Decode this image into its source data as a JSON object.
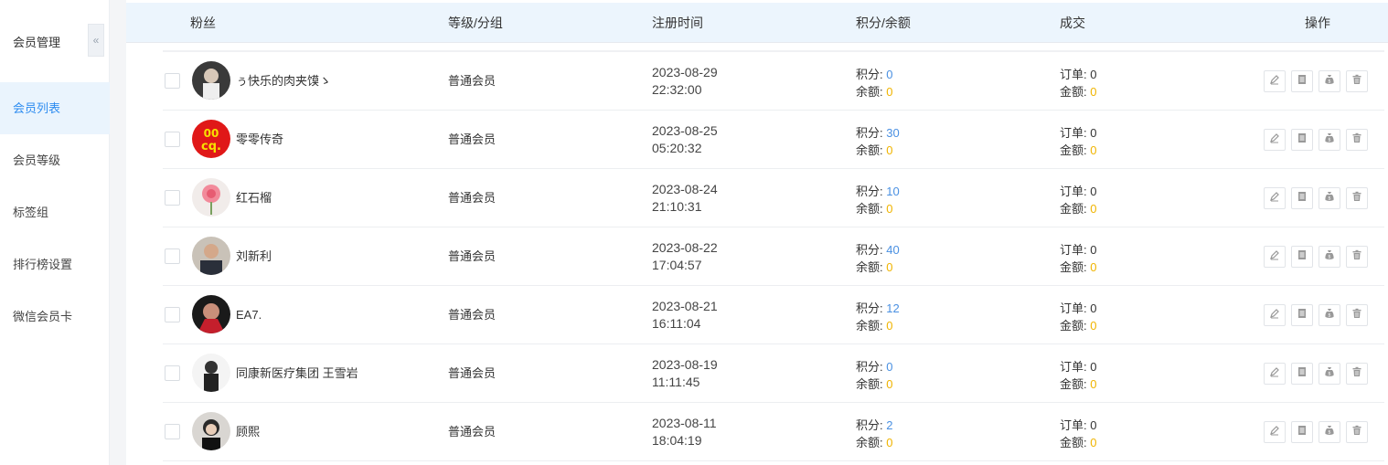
{
  "sidebar": {
    "title": "会员管理",
    "collapse_icon": "«",
    "items": [
      {
        "label": "会员列表",
        "active": true
      },
      {
        "label": "会员等级",
        "active": false
      },
      {
        "label": "标签组",
        "active": false
      },
      {
        "label": "排行榜设置",
        "active": false
      },
      {
        "label": "微信会员卡",
        "active": false
      }
    ]
  },
  "table": {
    "headers": {
      "fans": "粉丝",
      "level": "等级/分组",
      "reg_time": "注册时间",
      "points_balance": "积分/余额",
      "deal": "成交",
      "ops": "操作"
    },
    "labels": {
      "points": "积分: ",
      "balance": "余额: ",
      "orders": "订单: ",
      "amount": "金额: "
    },
    "rows": [
      {
        "name": "ぅ快乐的肉夹馍ゝ",
        "level": "普通会员",
        "date": "2023-08-29",
        "time": "22:32:00",
        "points": "0",
        "balance": "0",
        "orders": "0",
        "amount": "0"
      },
      {
        "name": "零零传奇",
        "level": "普通会员",
        "date": "2023-08-25",
        "time": "05:20:32",
        "points": "30",
        "balance": "0",
        "orders": "0",
        "amount": "0"
      },
      {
        "name": "红石榴",
        "level": "普通会员",
        "date": "2023-08-24",
        "time": "21:10:31",
        "points": "10",
        "balance": "0",
        "orders": "0",
        "amount": "0"
      },
      {
        "name": "刘新利",
        "level": "普通会员",
        "date": "2023-08-22",
        "time": "17:04:57",
        "points": "40",
        "balance": "0",
        "orders": "0",
        "amount": "0"
      },
      {
        "name": "EA7.",
        "level": "普通会员",
        "date": "2023-08-21",
        "time": "16:11:04",
        "points": "12",
        "balance": "0",
        "orders": "0",
        "amount": "0"
      },
      {
        "name": "同康新医疗集团 王雪岩",
        "level": "普通会员",
        "date": "2023-08-19",
        "time": "11:11:45",
        "points": "0",
        "balance": "0",
        "orders": "0",
        "amount": "0"
      },
      {
        "name": "顾熙",
        "level": "普通会员",
        "date": "2023-08-11",
        "time": "18:04:19",
        "points": "2",
        "balance": "0",
        "orders": "0",
        "amount": "0"
      }
    ]
  },
  "icons": [
    "edit-icon",
    "detail-icon",
    "money-bag-icon",
    "delete-icon"
  ],
  "colors": {
    "accent": "#2d8cf0",
    "points": "#4a90e2",
    "money": "#f0b400",
    "header_bg": "#ecf5fd"
  }
}
